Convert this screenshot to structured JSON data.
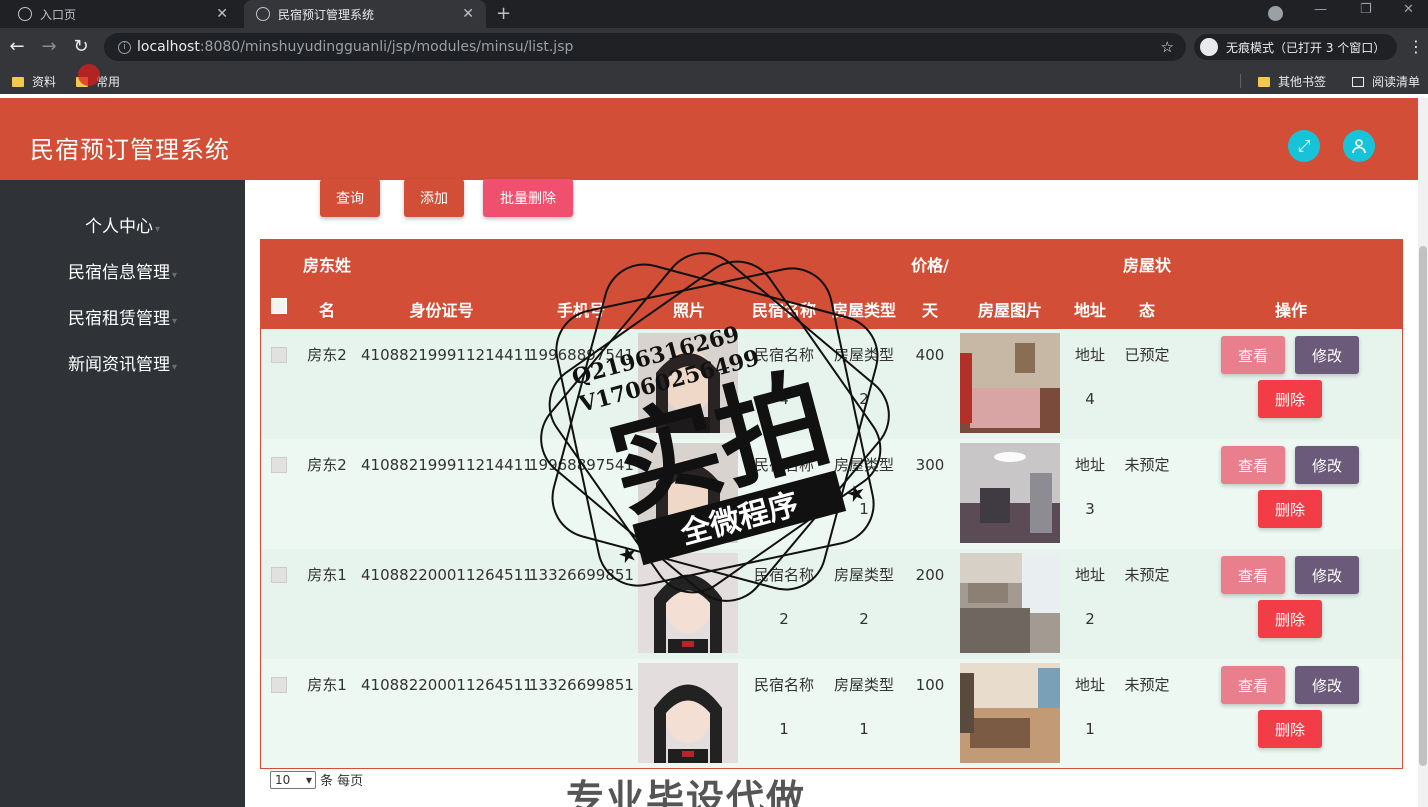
{
  "browser": {
    "tabs": [
      {
        "label": "入口页",
        "active": false
      },
      {
        "label": "民宿预订管理系统",
        "active": true
      }
    ],
    "url_host": "localhost",
    "url_rest": ":8080/minshuyudingguanli/jsp/modules/minsu/list.jsp",
    "incognito_label": "无痕模式（已打开 3 个窗口）",
    "bookmarks": [
      "资料",
      "常用"
    ],
    "bookmarks_right": [
      "其他书签",
      "阅读清单"
    ]
  },
  "app": {
    "title": "民宿预订管理系统",
    "sidebar": [
      {
        "label": "个人中心"
      },
      {
        "label": "民宿信息管理"
      },
      {
        "label": "民宿租赁管理"
      },
      {
        "label": "新闻资讯管理"
      }
    ],
    "toolbar": {
      "query": "查询",
      "add": "添加",
      "batch_delete": "批量删除"
    },
    "table": {
      "headers": {
        "landlord_line1": "房东姓",
        "landlord_line2": "名",
        "id_card": "身份证号",
        "phone": "手机号",
        "photo": "照片",
        "name": "民宿名称",
        "type": "房屋类型",
        "price_line1": "价格/",
        "price_line2": "天",
        "house_img": "房屋图片",
        "address": "地址",
        "status_line1": "房屋状",
        "status_line2": "态",
        "actions": "操作"
      },
      "rows": [
        {
          "landlord": "房东2",
          "id_card": "410882199911214411",
          "phone": "19968897541",
          "name1": "民宿名称",
          "name2": "4",
          "type1": "房屋类型",
          "type2": "2",
          "price": "400",
          "addr1": "地址",
          "addr2": "4",
          "status": "已预定"
        },
        {
          "landlord": "房东2",
          "id_card": "410882199911214411",
          "phone": "19968897541",
          "name1": "民宿名称",
          "name2": "3",
          "type1": "房屋类型",
          "type2": "1",
          "price": "300",
          "addr1": "地址",
          "addr2": "3",
          "status": "未预定"
        },
        {
          "landlord": "房东1",
          "id_card": "410882200011264511",
          "phone": "13326699851",
          "name1": "民宿名称",
          "name2": "2",
          "type1": "房屋类型",
          "type2": "2",
          "price": "200",
          "addr1": "地址",
          "addr2": "2",
          "status": "未预定"
        },
        {
          "landlord": "房东1",
          "id_card": "410882200011264511",
          "phone": "13326699851",
          "name1": "民宿名称",
          "name2": "1",
          "type1": "房屋类型",
          "type2": "1",
          "price": "100",
          "addr1": "地址",
          "addr2": "1",
          "status": "未预定"
        }
      ],
      "row_actions": {
        "view": "查看",
        "edit": "修改",
        "delete": "删除"
      }
    },
    "pager": {
      "page_size": "10",
      "suffix": "条 每页"
    }
  },
  "watermark": {
    "line1": "Q2196316269",
    "line2": "V17060256499",
    "big": "实拍",
    "banner": "全微程序",
    "bottom": "专业毕设代做"
  },
  "colors": {
    "brand": "#d24e36",
    "sidebar": "#2f3337",
    "row_bg": "#e7f4ee",
    "accent_cyan": "#17c3d9"
  }
}
